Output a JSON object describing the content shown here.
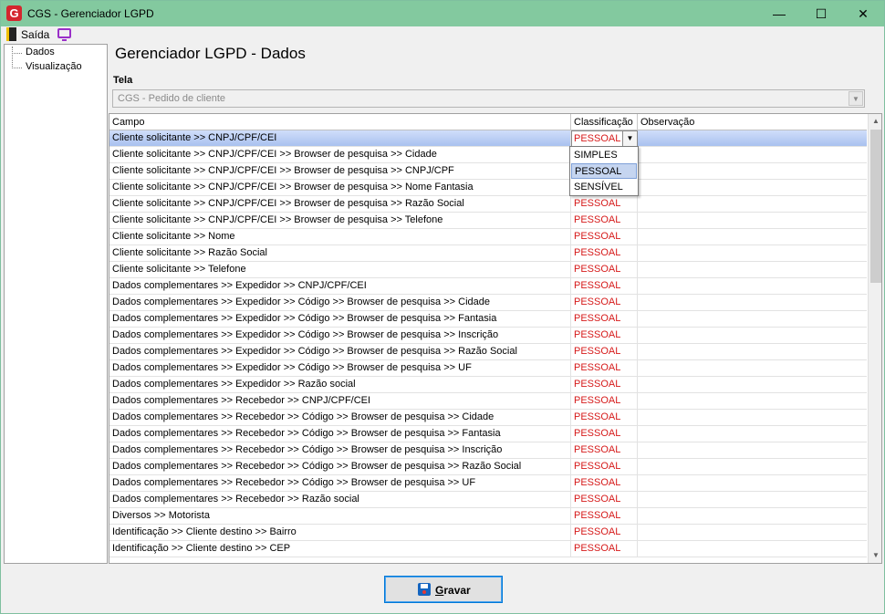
{
  "window": {
    "title": "CGS - Gerenciador LGPD",
    "min_glyph": "—",
    "max_glyph": "☐",
    "close_glyph": "✕"
  },
  "menu": {
    "exit_label": "Saída"
  },
  "tree": {
    "items": [
      "Dados",
      "Visualização"
    ]
  },
  "page": {
    "title": "Gerenciador LGPD - Dados"
  },
  "screen_selector": {
    "label": "Tela",
    "value": "CGS - Pedido de cliente"
  },
  "grid": {
    "columns": [
      "Campo",
      "Classificação",
      "Observação"
    ],
    "editing_value": "PESSOAL",
    "rows": [
      {
        "campo": "Cliente solicitante >> CNPJ/CPF/CEI",
        "classificacao": "PESSOAL",
        "observacao": ""
      },
      {
        "campo": "Cliente solicitante >> CNPJ/CPF/CEI >> Browser de pesquisa >> Cidade",
        "classificacao": "",
        "observacao": ""
      },
      {
        "campo": "Cliente solicitante >> CNPJ/CPF/CEI >> Browser de pesquisa >> CNPJ/CPF",
        "classificacao": "",
        "observacao": ""
      },
      {
        "campo": "Cliente solicitante >> CNPJ/CPF/CEI >> Browser de pesquisa >> Nome Fantasia",
        "classificacao": "",
        "observacao": ""
      },
      {
        "campo": "Cliente solicitante >> CNPJ/CPF/CEI >> Browser de pesquisa >> Razão Social",
        "classificacao": "PESSOAL",
        "observacao": ""
      },
      {
        "campo": "Cliente solicitante >> CNPJ/CPF/CEI >> Browser de pesquisa >> Telefone",
        "classificacao": "PESSOAL",
        "observacao": ""
      },
      {
        "campo": "Cliente solicitante >> Nome",
        "classificacao": "PESSOAL",
        "observacao": ""
      },
      {
        "campo": "Cliente solicitante >> Razão Social",
        "classificacao": "PESSOAL",
        "observacao": ""
      },
      {
        "campo": "Cliente solicitante >> Telefone",
        "classificacao": "PESSOAL",
        "observacao": ""
      },
      {
        "campo": "Dados complementares >> Expedidor >> CNPJ/CPF/CEI",
        "classificacao": "PESSOAL",
        "observacao": ""
      },
      {
        "campo": "Dados complementares >> Expedidor >> Código >> Browser de pesquisa >> Cidade",
        "classificacao": "PESSOAL",
        "observacao": ""
      },
      {
        "campo": "Dados complementares >> Expedidor >> Código >> Browser de pesquisa >> Fantasia",
        "classificacao": "PESSOAL",
        "observacao": ""
      },
      {
        "campo": "Dados complementares >> Expedidor >> Código >> Browser de pesquisa >> Inscrição",
        "classificacao": "PESSOAL",
        "observacao": ""
      },
      {
        "campo": "Dados complementares >> Expedidor >> Código >> Browser de pesquisa >> Razão Social",
        "classificacao": "PESSOAL",
        "observacao": ""
      },
      {
        "campo": "Dados complementares >> Expedidor >> Código >> Browser de pesquisa >> UF",
        "classificacao": "PESSOAL",
        "observacao": ""
      },
      {
        "campo": "Dados complementares >> Expedidor >> Razão social",
        "classificacao": "PESSOAL",
        "observacao": ""
      },
      {
        "campo": "Dados complementares >> Recebedor >> CNPJ/CPF/CEI",
        "classificacao": "PESSOAL",
        "observacao": ""
      },
      {
        "campo": "Dados complementares >> Recebedor >> Código >> Browser de pesquisa >> Cidade",
        "classificacao": "PESSOAL",
        "observacao": ""
      },
      {
        "campo": "Dados complementares >> Recebedor >> Código >> Browser de pesquisa >> Fantasia",
        "classificacao": "PESSOAL",
        "observacao": ""
      },
      {
        "campo": "Dados complementares >> Recebedor >> Código >> Browser de pesquisa >> Inscrição",
        "classificacao": "PESSOAL",
        "observacao": ""
      },
      {
        "campo": "Dados complementares >> Recebedor >> Código >> Browser de pesquisa >> Razão Social",
        "classificacao": "PESSOAL",
        "observacao": ""
      },
      {
        "campo": "Dados complementares >> Recebedor >> Código >> Browser de pesquisa >> UF",
        "classificacao": "PESSOAL",
        "observacao": ""
      },
      {
        "campo": "Dados complementares >> Recebedor >> Razão social",
        "classificacao": "PESSOAL",
        "observacao": ""
      },
      {
        "campo": "Diversos >> Motorista",
        "classificacao": "PESSOAL",
        "observacao": ""
      },
      {
        "campo": "Identificação  >> Cliente destino >>  Bairro",
        "classificacao": "PESSOAL",
        "observacao": ""
      },
      {
        "campo": "Identificação  >> Cliente destino >> CEP",
        "classificacao": "PESSOAL",
        "observacao": ""
      }
    ]
  },
  "classification_dropdown": {
    "options": [
      "SIMPLES",
      "PESSOAL",
      "SENSÍVEL"
    ],
    "highlighted": "PESSOAL"
  },
  "actions": {
    "save_label": "Gravar"
  },
  "colors": {
    "titlebar": "#83c99f",
    "classification_text": "#d61a1a",
    "selection": "#a9c1ef"
  }
}
